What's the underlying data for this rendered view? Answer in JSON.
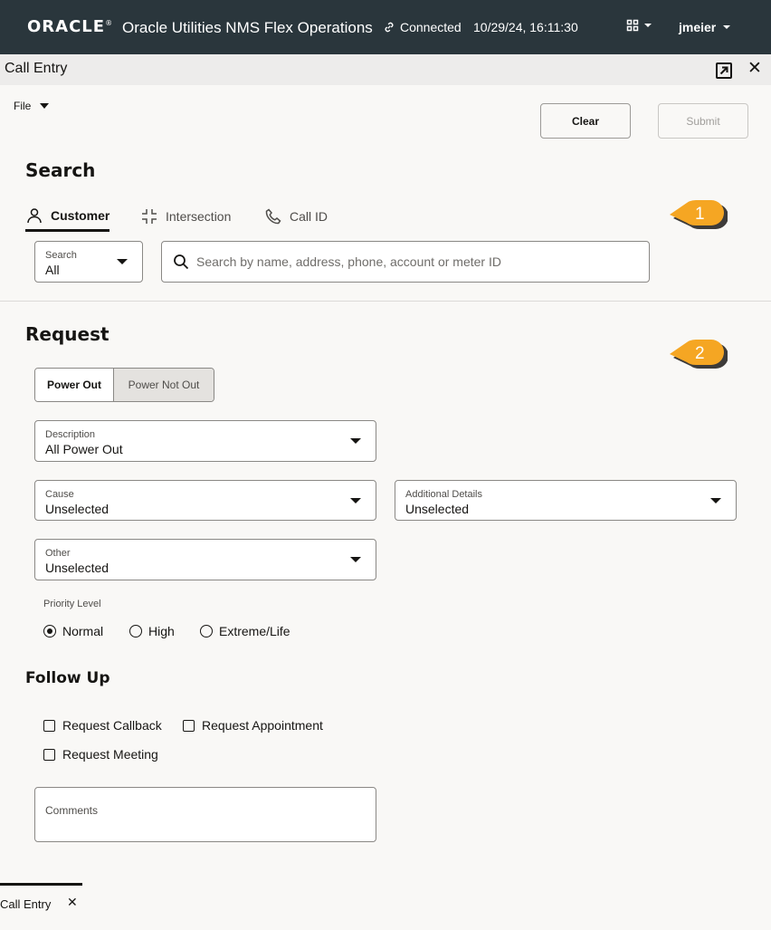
{
  "header": {
    "logo": "ORACLE",
    "logo_mark": "®",
    "app_title": "Oracle Utilities NMS Flex Operations",
    "connection_status": "Connected",
    "datetime": "10/29/24, 16:11:30",
    "user": "jmeier",
    "bg_color": "#2a363c"
  },
  "window": {
    "title": "Call Entry",
    "popout_icon": "popout-icon",
    "close_icon": "close-icon"
  },
  "toolbar": {
    "file_menu": "File",
    "clear_label": "Clear",
    "submit_label": "Submit"
  },
  "search": {
    "heading": "Search",
    "tabs": [
      {
        "label": "Customer",
        "icon": "person-icon",
        "active": true
      },
      {
        "label": "Intersection",
        "icon": "intersection-icon",
        "active": false
      },
      {
        "label": "Call ID",
        "icon": "phone-icon",
        "active": false
      }
    ],
    "scope_label": "Search",
    "scope_value": "All",
    "placeholder": "Search by name, address, phone, account or meter ID"
  },
  "callouts": [
    "1",
    "2"
  ],
  "request": {
    "heading": "Request",
    "toggle": {
      "selected": "Power Out",
      "other": "Power Not Out"
    },
    "description": {
      "label": "Description",
      "value": "All Power Out"
    },
    "cause": {
      "label": "Cause",
      "value": "Unselected"
    },
    "additional_details": {
      "label": "Additional Details",
      "value": "Unselected"
    },
    "other": {
      "label": "Other",
      "value": "Unselected"
    },
    "priority": {
      "label": "Priority Level",
      "options": [
        "Normal",
        "High",
        "Extreme/Life"
      ],
      "selected": "Normal"
    }
  },
  "follow_up": {
    "heading": "Follow Up",
    "options": [
      "Request Callback",
      "Request Appointment",
      "Request Meeting"
    ],
    "comments_label": "Comments"
  },
  "bottom_tabs": [
    {
      "label": "Call Entry"
    }
  ],
  "colors": {
    "accent": "#161513",
    "callout": "#f5a623"
  }
}
